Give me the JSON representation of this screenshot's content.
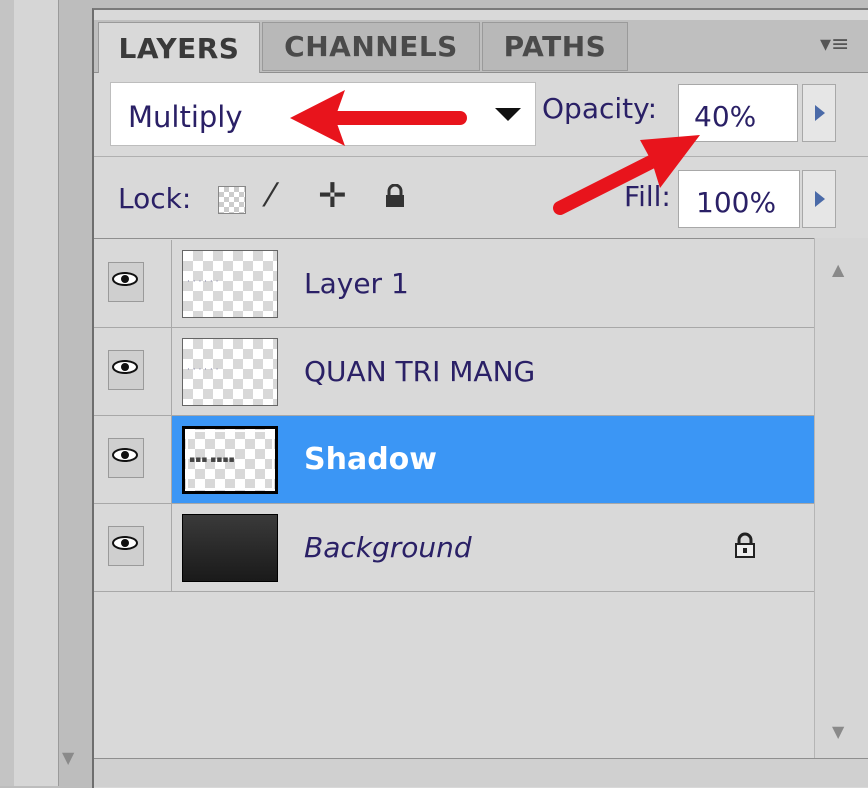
{
  "tabs": [
    {
      "label": "LAYERS",
      "active": true
    },
    {
      "label": "CHANNELS",
      "active": false
    },
    {
      "label": "PATHS",
      "active": false
    }
  ],
  "panel_menu_icon": "panel-menu-icon",
  "blend": {
    "value": "Multiply"
  },
  "opacity": {
    "label": "Opacity:",
    "value": "40%"
  },
  "lock": {
    "label": "Lock:",
    "icons": [
      "lock-transparent-icon",
      "lock-brush-icon",
      "lock-move-icon",
      "lock-all-icon"
    ]
  },
  "fill": {
    "label": "Fill:",
    "value": "100%"
  },
  "layers": [
    {
      "name": "Layer 1",
      "visible": true,
      "selected": false,
      "locked": false
    },
    {
      "name": "QUAN TRI MANG",
      "visible": true,
      "selected": false,
      "locked": false
    },
    {
      "name": "Shadow",
      "visible": true,
      "selected": true,
      "locked": false
    },
    {
      "name": "Background",
      "visible": true,
      "selected": false,
      "locked": true
    }
  ],
  "colors": {
    "selection": "#3b96f5",
    "arrow": "#e8141c",
    "text": "#2a2066"
  }
}
